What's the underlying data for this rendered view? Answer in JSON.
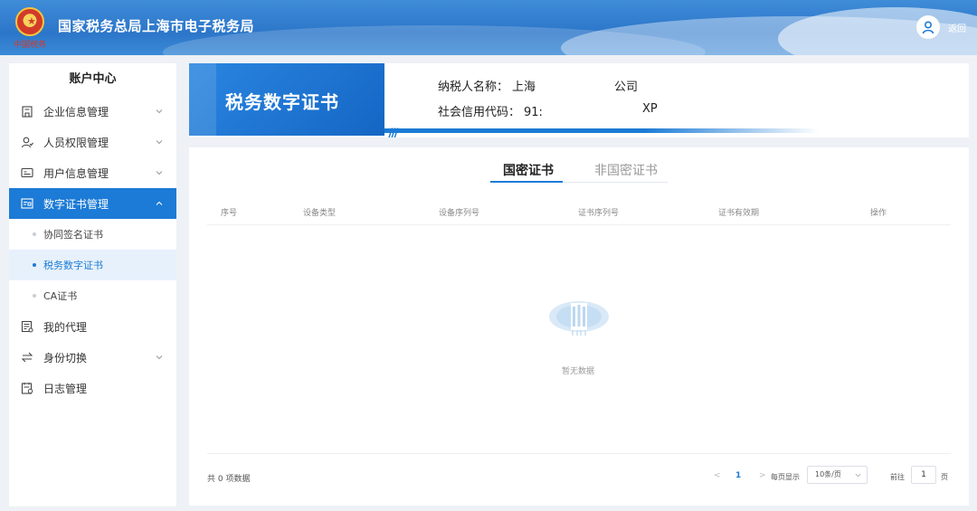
{
  "header": {
    "emblem_caption": "中国税务",
    "site_title": "国家税务总局上海市电子税务局",
    "back_label": "返回"
  },
  "sidebar": {
    "title": "账户中心",
    "items": [
      {
        "label": "企业信息管理",
        "icon": "building-icon",
        "expandable": true
      },
      {
        "label": "人员权限管理",
        "icon": "user-permission-icon",
        "expandable": true
      },
      {
        "label": "用户信息管理",
        "icon": "id-card-icon",
        "expandable": true
      },
      {
        "label": "数字证书管理",
        "icon": "certificate-icon",
        "expandable": true,
        "expanded": true,
        "active": true
      },
      {
        "label": "我的代理",
        "icon": "agent-icon",
        "expandable": false
      },
      {
        "label": "身份切换",
        "icon": "switch-icon",
        "expandable": true
      },
      {
        "label": "日志管理",
        "icon": "log-icon",
        "expandable": false
      }
    ],
    "subitems": [
      {
        "label": "协同签名证书",
        "active": false
      },
      {
        "label": "税务数字证书",
        "active": true
      },
      {
        "label": "CA证书",
        "active": false
      }
    ]
  },
  "banner": {
    "title": "税务数字证书",
    "taxpayer_label": "纳税人名称：",
    "taxpayer_value_a": "上海",
    "taxpayer_value_b": "公司",
    "credit_label": "社会信用代码：",
    "credit_value_a": "91:",
    "credit_value_b": "XP"
  },
  "tabs": [
    {
      "label": "国密证书",
      "active": true
    },
    {
      "label": "非国密证书",
      "active": false
    }
  ],
  "table": {
    "columns": [
      "序号",
      "设备类型",
      "设备序列号",
      "证书序列号",
      "证书有效期",
      "操作"
    ],
    "rows": [],
    "empty_text": "暂无数据"
  },
  "pagination": {
    "total_text": "共 0 项数据",
    "prev": "<",
    "current_page": "1",
    "next": ">",
    "page_size_label": "每页显示",
    "page_size_value": "10条/页",
    "goto_label": "前往",
    "goto_value": "1",
    "page_suffix": "页"
  },
  "colors": {
    "primary": "#1c7bd6",
    "header_bg": "#2c76c9",
    "page_bg": "#eef1f5"
  }
}
